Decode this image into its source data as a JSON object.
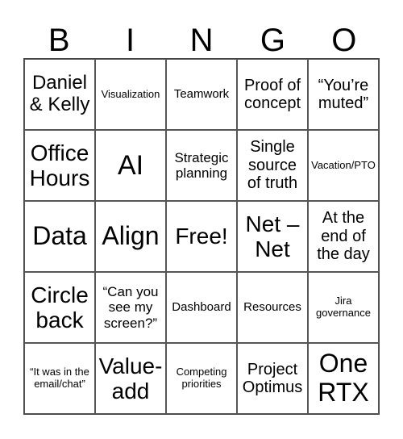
{
  "header": {
    "letters": [
      "B",
      "I",
      "N",
      "G",
      "O"
    ]
  },
  "cells": [
    "Daniel & Kelly",
    "Visualization",
    "Teamwork",
    "Proof of concept",
    "“You’re muted”",
    "Office Hours",
    "AI",
    "Strategic planning",
    "Single source of truth",
    "Vacation/PTO",
    "Data",
    "Align",
    "Free!",
    "Net – Net",
    "At the end of the day",
    "Circle back",
    "“Can you see my screen?”",
    "Dashboard",
    "Resources",
    "Jira governance",
    "“It was in the email/chat”",
    "Value-add",
    "Competing priorities",
    "Project Optimus",
    "One RTX"
  ],
  "free_space": "Free!"
}
